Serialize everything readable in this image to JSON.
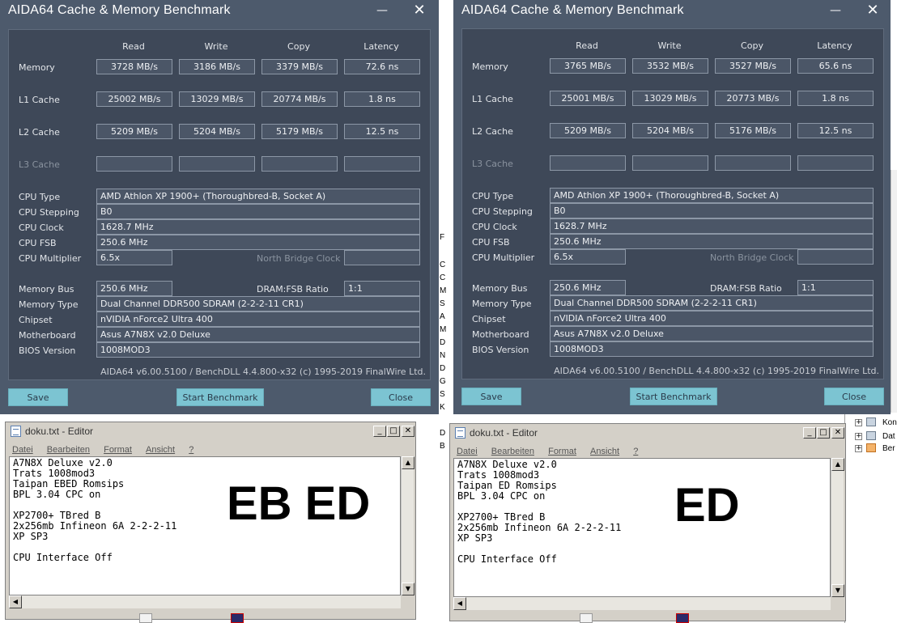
{
  "aida_left": {
    "title": "AIDA64 Cache & Memory Benchmark",
    "min": "—",
    "close": "✕",
    "col_headers": [
      "Read",
      "Write",
      "Copy",
      "Latency"
    ],
    "rows": [
      {
        "label": "Memory",
        "values": [
          "3728 MB/s",
          "3186 MB/s",
          "3379 MB/s",
          "72.6 ns"
        ]
      },
      {
        "label": "L1 Cache",
        "values": [
          "25002 MB/s",
          "13029 MB/s",
          "20774 MB/s",
          "1.8 ns"
        ]
      },
      {
        "label": "L2 Cache",
        "values": [
          "5209 MB/s",
          "5204 MB/s",
          "5179 MB/s",
          "12.5 ns"
        ]
      },
      {
        "label": "L3 Cache",
        "values": [
          "",
          "",
          "",
          ""
        ]
      }
    ],
    "cpu_type_label": "CPU Type",
    "cpu_type": "AMD Athlon XP 1900+  (Thoroughbred-B, Socket A)",
    "cpu_stepping_label": "CPU Stepping",
    "cpu_stepping": "B0",
    "cpu_clock_label": "CPU Clock",
    "cpu_clock": "1628.7 MHz",
    "cpu_fsb_label": "CPU FSB",
    "cpu_fsb": "250.6 MHz",
    "cpu_multiplier_label": "CPU Multiplier",
    "cpu_multiplier": "6.5x",
    "nb_clock_label": "North Bridge Clock",
    "nb_clock": "",
    "memory_bus_label": "Memory Bus",
    "memory_bus": "250.6 MHz",
    "dram_fsb_label": "DRAM:FSB Ratio",
    "dram_fsb": "1:1",
    "memory_type_label": "Memory Type",
    "memory_type": "Dual Channel DDR500 SDRAM  (2-2-2-11 CR1)",
    "chipset_label": "Chipset",
    "chipset": "nVIDIA nForce2 Ultra 400",
    "motherboard_label": "Motherboard",
    "motherboard": "Asus A7N8X v2.0 Deluxe",
    "bios_label": "BIOS Version",
    "bios": "1008MOD3",
    "footer": "AIDA64 v6.00.5100 / BenchDLL 4.4.800-x32  (c) 1995-2019 FinalWire Ltd.",
    "save": "Save",
    "start": "Start Benchmark",
    "close_btn": "Close"
  },
  "aida_right": {
    "title": "AIDA64 Cache & Memory Benchmark",
    "min": "—",
    "close": "✕",
    "col_headers": [
      "Read",
      "Write",
      "Copy",
      "Latency"
    ],
    "rows": [
      {
        "label": "Memory",
        "values": [
          "3765 MB/s",
          "3532 MB/s",
          "3527 MB/s",
          "65.6 ns"
        ]
      },
      {
        "label": "L1 Cache",
        "values": [
          "25001 MB/s",
          "13029 MB/s",
          "20773 MB/s",
          "1.8 ns"
        ]
      },
      {
        "label": "L2 Cache",
        "values": [
          "5209 MB/s",
          "5204 MB/s",
          "5176 MB/s",
          "12.5 ns"
        ]
      },
      {
        "label": "L3 Cache",
        "values": [
          "",
          "",
          "",
          ""
        ]
      }
    ],
    "cpu_type_label": "CPU Type",
    "cpu_type": "AMD Athlon XP 1900+  (Thoroughbred-B, Socket A)",
    "cpu_stepping_label": "CPU Stepping",
    "cpu_stepping": "B0",
    "cpu_clock_label": "CPU Clock",
    "cpu_clock": "1628.7 MHz",
    "cpu_fsb_label": "CPU FSB",
    "cpu_fsb": "250.6 MHz",
    "cpu_multiplier_label": "CPU Multiplier",
    "cpu_multiplier": "6.5x",
    "nb_clock_label": "North Bridge Clock",
    "nb_clock": "",
    "memory_bus_label": "Memory Bus",
    "memory_bus": "250.6 MHz",
    "dram_fsb_label": "DRAM:FSB Ratio",
    "dram_fsb": "1:1",
    "memory_type_label": "Memory Type",
    "memory_type": "Dual Channel DDR500 SDRAM  (2-2-2-11 CR1)",
    "chipset_label": "Chipset",
    "chipset": "nVIDIA nForce2 Ultra 400",
    "motherboard_label": "Motherboard",
    "motherboard": "Asus A7N8X v2.0 Deluxe",
    "bios_label": "BIOS Version",
    "bios": "1008MOD3",
    "footer": "AIDA64 v6.00.5100 / BenchDLL 4.4.800-x32  (c) 1995-2019 FinalWire Ltd.",
    "save": "Save",
    "start": "Start Benchmark",
    "close_btn": "Close"
  },
  "editor_left": {
    "title": "doku.txt - Editor",
    "menu": [
      "Datei",
      "Bearbeiten",
      "Format",
      "Ansicht",
      "?"
    ],
    "lines": [
      "A7N8X Deluxe v2.0",
      "Trats 1008mod3",
      "Taipan EBED Romsips",
      "BPL 3.04 CPC on",
      "",
      "XP2700+ TBred B",
      "2x256mb Infineon 6A 2-2-2-11",
      "XP SP3",
      "",
      "CPU Interface Off"
    ],
    "big": "EB ED",
    "ctrl_min": "_",
    "ctrl_max": "□",
    "ctrl_close": "✕"
  },
  "editor_right": {
    "title": "doku.txt - Editor",
    "menu": [
      "Datei",
      "Bearbeiten",
      "Format",
      "Ansicht",
      "?"
    ],
    "lines": [
      "A7N8X Deluxe v2.0",
      "Trats 1008mod3",
      "Taipan ED Romsips",
      "BPL 3.04 CPC on",
      "",
      "XP2700+ TBred B",
      "2x256mb Infineon 6A 2-2-2-11",
      "XP SP3",
      "",
      "CPU Interface Off"
    ],
    "big": "ED",
    "ctrl_min": "_",
    "ctrl_max": "□",
    "ctrl_close": "✕"
  },
  "background_tree": {
    "items": [
      "Kon",
      "Dat",
      "Ber"
    ]
  },
  "background_edge": {
    "chars": [
      "F",
      "C",
      "C",
      "M",
      "S",
      "A",
      "M",
      "D",
      "N",
      "D",
      "G",
      "S",
      "K",
      "D",
      "B"
    ]
  }
}
